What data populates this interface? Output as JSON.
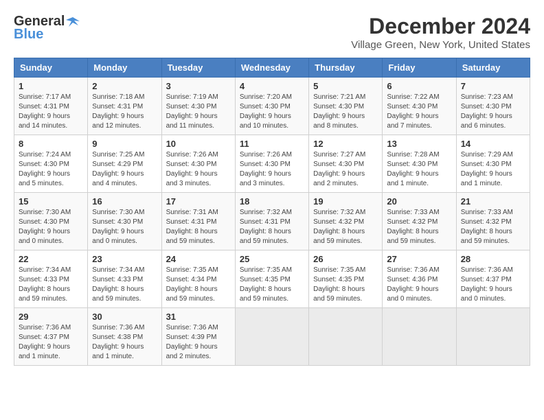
{
  "header": {
    "logo_line1": "General",
    "logo_line2": "Blue",
    "month_title": "December 2024",
    "location": "Village Green, New York, United States"
  },
  "calendar": {
    "days_of_week": [
      "Sunday",
      "Monday",
      "Tuesday",
      "Wednesday",
      "Thursday",
      "Friday",
      "Saturday"
    ],
    "weeks": [
      [
        {
          "day": "",
          "info": ""
        },
        {
          "day": "2",
          "info": "Sunrise: 7:18 AM\nSunset: 4:31 PM\nDaylight: 9 hours and 12 minutes."
        },
        {
          "day": "3",
          "info": "Sunrise: 7:19 AM\nSunset: 4:30 PM\nDaylight: 9 hours and 11 minutes."
        },
        {
          "day": "4",
          "info": "Sunrise: 7:20 AM\nSunset: 4:30 PM\nDaylight: 9 hours and 10 minutes."
        },
        {
          "day": "5",
          "info": "Sunrise: 7:21 AM\nSunset: 4:30 PM\nDaylight: 9 hours and 8 minutes."
        },
        {
          "day": "6",
          "info": "Sunrise: 7:22 AM\nSunset: 4:30 PM\nDaylight: 9 hours and 7 minutes."
        },
        {
          "day": "7",
          "info": "Sunrise: 7:23 AM\nSunset: 4:30 PM\nDaylight: 9 hours and 6 minutes."
        }
      ],
      [
        {
          "day": "1",
          "info": "Sunrise: 7:17 AM\nSunset: 4:31 PM\nDaylight: 9 hours and 14 minutes.",
          "first_row_sunday": true
        },
        {
          "day": "9",
          "info": "Sunrise: 7:25 AM\nSunset: 4:29 PM\nDaylight: 9 hours and 4 minutes."
        },
        {
          "day": "10",
          "info": "Sunrise: 7:26 AM\nSunset: 4:30 PM\nDaylight: 9 hours and 3 minutes."
        },
        {
          "day": "11",
          "info": "Sunrise: 7:26 AM\nSunset: 4:30 PM\nDaylight: 9 hours and 3 minutes."
        },
        {
          "day": "12",
          "info": "Sunrise: 7:27 AM\nSunset: 4:30 PM\nDaylight: 9 hours and 2 minutes."
        },
        {
          "day": "13",
          "info": "Sunrise: 7:28 AM\nSunset: 4:30 PM\nDaylight: 9 hours and 1 minute."
        },
        {
          "day": "14",
          "info": "Sunrise: 7:29 AM\nSunset: 4:30 PM\nDaylight: 9 hours and 1 minute."
        }
      ],
      [
        {
          "day": "8",
          "info": "Sunrise: 7:24 AM\nSunset: 4:30 PM\nDaylight: 9 hours and 5 minutes.",
          "second_row_sunday": true
        },
        {
          "day": "16",
          "info": "Sunrise: 7:30 AM\nSunset: 4:30 PM\nDaylight: 9 hours and 0 minutes."
        },
        {
          "day": "17",
          "info": "Sunrise: 7:31 AM\nSunset: 4:31 PM\nDaylight: 8 hours and 59 minutes."
        },
        {
          "day": "18",
          "info": "Sunrise: 7:32 AM\nSunset: 4:31 PM\nDaylight: 8 hours and 59 minutes."
        },
        {
          "day": "19",
          "info": "Sunrise: 7:32 AM\nSunset: 4:32 PM\nDaylight: 8 hours and 59 minutes."
        },
        {
          "day": "20",
          "info": "Sunrise: 7:33 AM\nSunset: 4:32 PM\nDaylight: 8 hours and 59 minutes."
        },
        {
          "day": "21",
          "info": "Sunrise: 7:33 AM\nSunset: 4:32 PM\nDaylight: 8 hours and 59 minutes."
        }
      ],
      [
        {
          "day": "15",
          "info": "Sunrise: 7:30 AM\nSunset: 4:30 PM\nDaylight: 9 hours and 0 minutes.",
          "third_row_sunday": true
        },
        {
          "day": "23",
          "info": "Sunrise: 7:34 AM\nSunset: 4:33 PM\nDaylight: 8 hours and 59 minutes."
        },
        {
          "day": "24",
          "info": "Sunrise: 7:35 AM\nSunset: 4:34 PM\nDaylight: 8 hours and 59 minutes."
        },
        {
          "day": "25",
          "info": "Sunrise: 7:35 AM\nSunset: 4:35 PM\nDaylight: 8 hours and 59 minutes."
        },
        {
          "day": "26",
          "info": "Sunrise: 7:35 AM\nSunset: 4:35 PM\nDaylight: 8 hours and 59 minutes."
        },
        {
          "day": "27",
          "info": "Sunrise: 7:36 AM\nSunset: 4:36 PM\nDaylight: 9 hours and 0 minutes."
        },
        {
          "day": "28",
          "info": "Sunrise: 7:36 AM\nSunset: 4:37 PM\nDaylight: 9 hours and 0 minutes."
        }
      ],
      [
        {
          "day": "22",
          "info": "Sunrise: 7:34 AM\nSunset: 4:33 PM\nDaylight: 8 hours and 59 minutes.",
          "fourth_row_sunday": true
        },
        {
          "day": "30",
          "info": "Sunrise: 7:36 AM\nSunset: 4:38 PM\nDaylight: 9 hours and 1 minute."
        },
        {
          "day": "31",
          "info": "Sunrise: 7:36 AM\nSunset: 4:39 PM\nDaylight: 9 hours and 2 minutes."
        },
        {
          "day": "",
          "info": ""
        },
        {
          "day": "",
          "info": ""
        },
        {
          "day": "",
          "info": ""
        },
        {
          "day": "",
          "info": ""
        }
      ],
      [
        {
          "day": "29",
          "info": "Sunrise: 7:36 AM\nSunset: 4:37 PM\nDaylight: 9 hours and 1 minute.",
          "fifth_row_sunday": true
        },
        {
          "day": "",
          "info": ""
        },
        {
          "day": "",
          "info": ""
        },
        {
          "day": "",
          "info": ""
        },
        {
          "day": "",
          "info": ""
        },
        {
          "day": "",
          "info": ""
        },
        {
          "day": "",
          "info": ""
        }
      ]
    ]
  }
}
